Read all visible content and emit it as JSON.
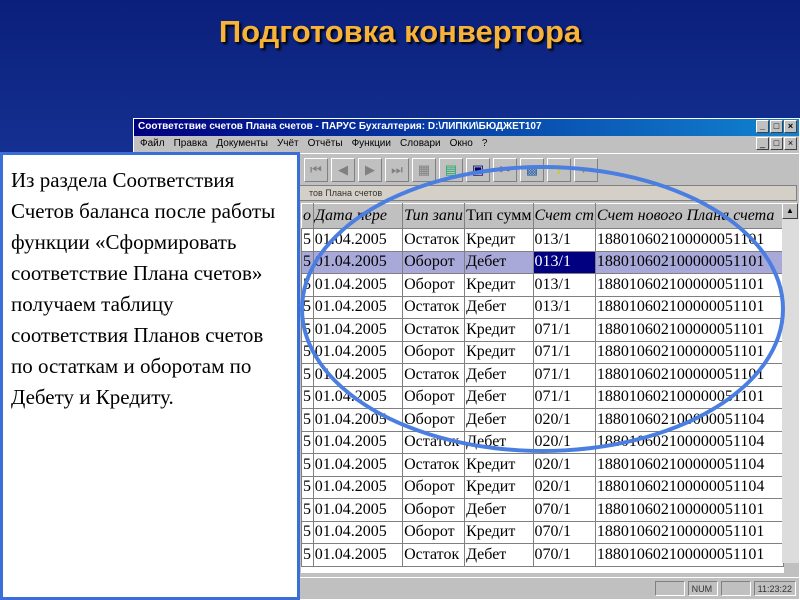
{
  "slide_title": "Подготовка конвертора",
  "window": {
    "title": "Соответствие счетов Плана счетов - ПАРУС Бухгалтерия: D:\\ЛИПКИ\\БЮДЖЕТ107",
    "menu": [
      "Файл",
      "Правка",
      "Документы",
      "Учёт",
      "Отчёты",
      "Функции",
      "Словари",
      "Окно",
      "?"
    ],
    "subtitle": "тов Плана счетов",
    "columns": [
      "о",
      "Дата пере",
      "Тип запи",
      "Тип сумм",
      "Счет ст",
      "Счет нового Плана счета"
    ],
    "rows": [
      [
        "5",
        "01.04.2005",
        "Остаток",
        "Кредит",
        "013/1",
        "188010602100000051101"
      ],
      [
        "5",
        "01.04.2005",
        "Оборот",
        "Дебет",
        "013/1",
        "188010602100000051101"
      ],
      [
        "5",
        "01.04.2005",
        "Оборот",
        "Кредит",
        "013/1",
        "188010602100000051101"
      ],
      [
        "5",
        "01.04.2005",
        "Остаток",
        "Дебет",
        "013/1",
        "188010602100000051101"
      ],
      [
        "5",
        "01.04.2005",
        "Остаток",
        "Кредит",
        "071/1",
        "188010602100000051101"
      ],
      [
        "5",
        "01.04.2005",
        "Оборот",
        "Кредит",
        "071/1",
        "188010602100000051101"
      ],
      [
        "5",
        "01.04.2005",
        "Остаток",
        "Дебет",
        "071/1",
        "188010602100000051101"
      ],
      [
        "5",
        "01.04.2005",
        "Оборот",
        "Дебет",
        "071/1",
        "188010602100000051101"
      ],
      [
        "5",
        "01.04.2005",
        "Оборот",
        "Дебет",
        "020/1",
        "188010602100000051104"
      ],
      [
        "5",
        "01.04.2005",
        "Остаток",
        "Дебет",
        "020/1",
        "188010602100000051104"
      ],
      [
        "5",
        "01.04.2005",
        "Остаток",
        "Кредит",
        "020/1",
        "188010602100000051104"
      ],
      [
        "5",
        "01.04.2005",
        "Оборот",
        "Кредит",
        "020/1",
        "188010602100000051104"
      ],
      [
        "5",
        "01.04.2005",
        "Оборот",
        "Дебет",
        "070/1",
        "188010602100000051101"
      ],
      [
        "5",
        "01.04.2005",
        "Оборот",
        "Кредит",
        "070/1",
        "188010602100000051101"
      ],
      [
        "5",
        "01.04.2005",
        "Остаток",
        "Дебет",
        "070/1",
        "188010602100000051101"
      ]
    ],
    "selected_row": 1,
    "status": {
      "num": "NUM",
      "time": "11:23:22"
    }
  },
  "description": "Из раздела Соответствия Счетов баланса после работы функции «Сформировать соответствие Плана счетов» получаем таблицу соответствия Планов счетов по остаткам и оборотам по Дебету и Кредиту."
}
